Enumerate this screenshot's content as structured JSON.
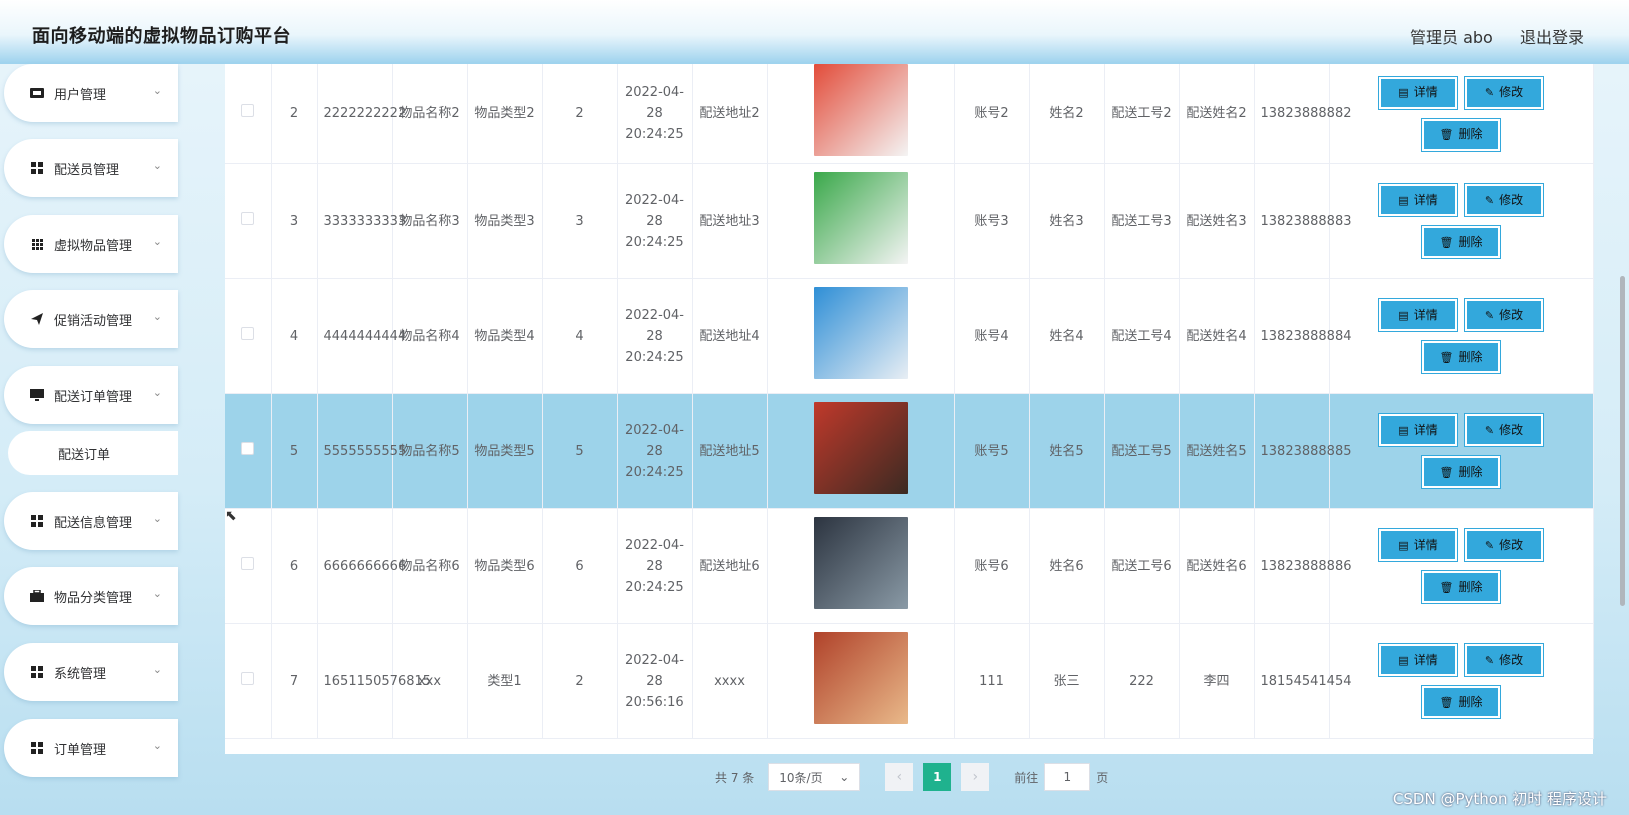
{
  "header": {
    "title": "面向移动端的虚拟物品订购平台",
    "user": "管理员 abo",
    "logout": "退出登录"
  },
  "sidebar": {
    "items": [
      {
        "label": "用户管理",
        "icon": "user-card-icon"
      },
      {
        "label": "配送员管理",
        "icon": "grid-icon"
      },
      {
        "label": "虚拟物品管理",
        "icon": "grid9-icon"
      },
      {
        "label": "促销活动管理",
        "icon": "paper-plane-icon"
      },
      {
        "label": "配送订单管理",
        "icon": "monitor-icon"
      },
      {
        "label": "配送信息管理",
        "icon": "grid-icon"
      },
      {
        "label": "物品分类管理",
        "icon": "briefcase-icon"
      },
      {
        "label": "系统管理",
        "icon": "grid-icon"
      },
      {
        "label": "订单管理",
        "icon": "grid-icon"
      }
    ],
    "submenu": "配送订单"
  },
  "table": {
    "rows": [
      {
        "index": "2",
        "order_no": "2222222222",
        "name": "物品名称2",
        "type": "物品类型2",
        "qty": "2",
        "time": "2022-04-28 20:24:25",
        "address": "配送地址2",
        "account": "账号2",
        "person": "姓名2",
        "courier_no": "配送工号2",
        "courier_name": "配送姓名2",
        "phone": "13823888882",
        "image_colors": [
          "#e24c3a",
          "#f4f4f4"
        ]
      },
      {
        "index": "3",
        "order_no": "3333333333",
        "name": "物品名称3",
        "type": "物品类型3",
        "qty": "3",
        "time": "2022-04-28 20:24:25",
        "address": "配送地址3",
        "account": "账号3",
        "person": "姓名3",
        "courier_no": "配送工号3",
        "courier_name": "配送姓名3",
        "phone": "13823888883",
        "image_colors": [
          "#3aa84a",
          "#f4f4f4"
        ]
      },
      {
        "index": "4",
        "order_no": "4444444444",
        "name": "物品名称4",
        "type": "物品类型4",
        "qty": "4",
        "time": "2022-04-28 20:24:25",
        "address": "配送地址4",
        "account": "账号4",
        "person": "姓名4",
        "courier_no": "配送工号4",
        "courier_name": "配送姓名4",
        "phone": "13823888884",
        "image_colors": [
          "#2f8fd6",
          "#e8eef4"
        ]
      },
      {
        "index": "5",
        "order_no": "5555555555",
        "name": "物品名称5",
        "type": "物品类型5",
        "qty": "5",
        "time": "2022-04-28 20:24:25",
        "address": "配送地址5",
        "account": "账号5",
        "person": "姓名5",
        "courier_no": "配送工号5",
        "courier_name": "配送姓名5",
        "phone": "13823888885",
        "image_colors": [
          "#c0392b",
          "#3b2a22"
        ]
      },
      {
        "index": "6",
        "order_no": "6666666666",
        "name": "物品名称6",
        "type": "物品类型6",
        "qty": "6",
        "time": "2022-04-28 20:24:25",
        "address": "配送地址6",
        "account": "账号6",
        "person": "姓名6",
        "courier_no": "配送工号6",
        "courier_name": "配送姓名6",
        "phone": "13823888886",
        "image_colors": [
          "#2c3440",
          "#8a9aa6"
        ]
      },
      {
        "index": "7",
        "order_no": "1651150576815",
        "name": "xxx",
        "type": "类型1",
        "qty": "2",
        "time": "2022-04-28 20:56:16",
        "address": "xxxx",
        "account": "111",
        "person": "张三",
        "courier_no": "222",
        "courier_name": "李四",
        "phone": "18154541454",
        "image_colors": [
          "#b0422a",
          "#e9b98a"
        ]
      }
    ],
    "highlight_row": "5",
    "buttons": {
      "detail": "详情",
      "edit": "修改",
      "delete": "删除"
    }
  },
  "pagination": {
    "total": "共 7 条",
    "page_size": "10条/页",
    "current": "1",
    "goto_prefix": "前往",
    "goto_value": "1",
    "goto_suffix": "页"
  },
  "watermark": "CSDN @Python 初时 程序设计"
}
